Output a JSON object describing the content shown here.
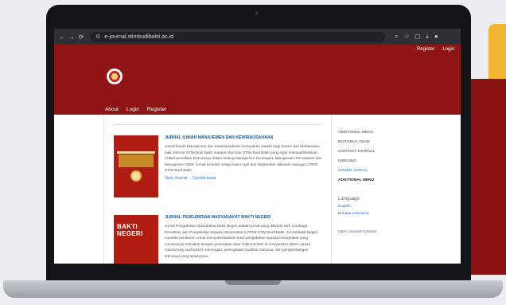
{
  "browser": {
    "url": "e-journal.stimbudibakti.ac.id",
    "nav": {
      "back": "←",
      "forward": "→",
      "reload": "⟳"
    },
    "tab_icon": "tune-icon"
  },
  "site": {
    "top_links": {
      "register": "Register",
      "login": "Login"
    },
    "nav": {
      "about": "About",
      "login": "Login",
      "register": "Register"
    }
  },
  "journals": [
    {
      "cover_title": "",
      "title": "JURNAL ILMIAH MANAJEMEN DAN KEWIRAUSAHAAN",
      "description": "Jurnal Ilmiah Manajemen dan Kewirausahaan merupakan wadah bagi Dosen dan Mahasiswa, baik internal STIM Budi Bakti maupun dari luar STIM Budi Bakti yang ingin mempublikasikan Artikel penelitian khususnya dalam bidang Manajemen Keuangan, Manajemen Pemasaran dan Manajemen SDM. Jurnal ini terbit setiap bulan April dan September dibawah naungan LPPM STIM Budi Bakti",
      "view_journal": "View Journal",
      "current_issue": "Current Issue"
    },
    {
      "cover_title": "BAKTI NEGERI",
      "title": "JURNAL PENGABDIAN MASYARAKAT BAKTI NEGERI",
      "description": "Jurnal Pengabdian Masyarakat Bakti Negeri adalah jurnal yang dikelola oleh Lembaga Penelitian dan Pengabdian kepada Masyarakat (LPPM) STIM Budi Bakti. Jurnal Bakti Negeri memiliki komitmen untuk menyebarluaskan hasil pengabdian kepada masyarakat yang mempunyai relevansi dengan penerapan atau implementasi di masyarakat dalam upaya mandorong usaha kecil menengah, peningkatan kualitas manusia, dan pengembangan teknologi yang tepat guna."
    }
  ],
  "sidebar": {
    "items": [
      "ADDITIONAL MENU",
      "EDITORIAL TEAM",
      "CONTACT JOURNAL",
      "INDEXING",
      "ORDER JURNAL",
      "ADDITIONAL MENU"
    ],
    "language_title": "Language",
    "languages": [
      "English",
      "Bahasa Indonesia"
    ],
    "ojs": "Open Journal Systems"
  },
  "colors": {
    "header": "#8f1515",
    "accent_yellow": "#f2b531",
    "link": "#2a70c2"
  }
}
